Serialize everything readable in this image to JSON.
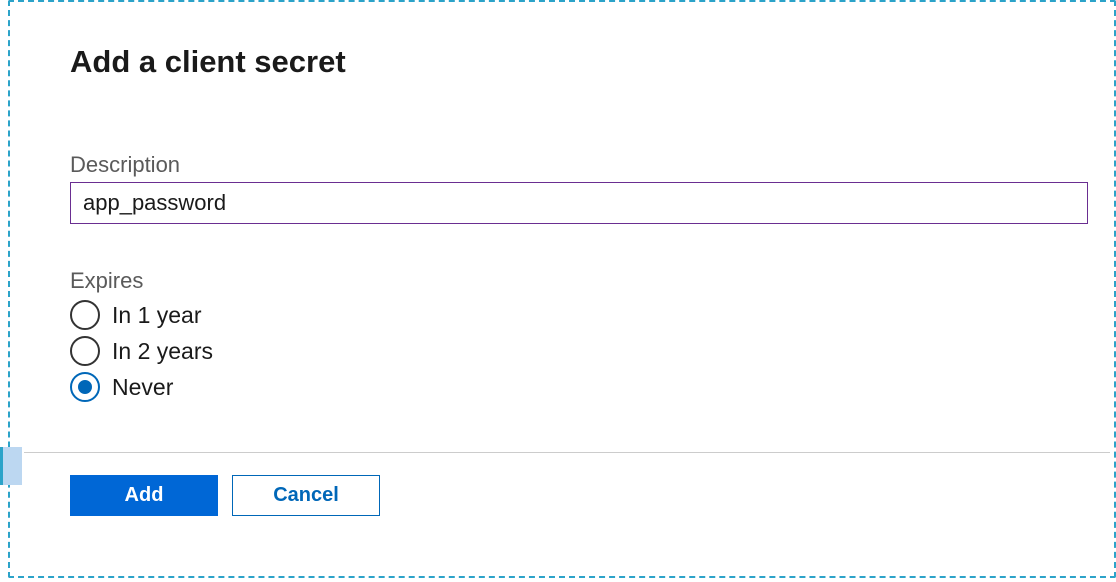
{
  "title": "Add a client secret",
  "description": {
    "label": "Description",
    "value": "app_password"
  },
  "expires": {
    "label": "Expires",
    "options": [
      {
        "label": "In 1 year",
        "selected": false
      },
      {
        "label": "In 2 years",
        "selected": false
      },
      {
        "label": "Never",
        "selected": true
      }
    ]
  },
  "buttons": {
    "add": "Add",
    "cancel": "Cancel"
  }
}
